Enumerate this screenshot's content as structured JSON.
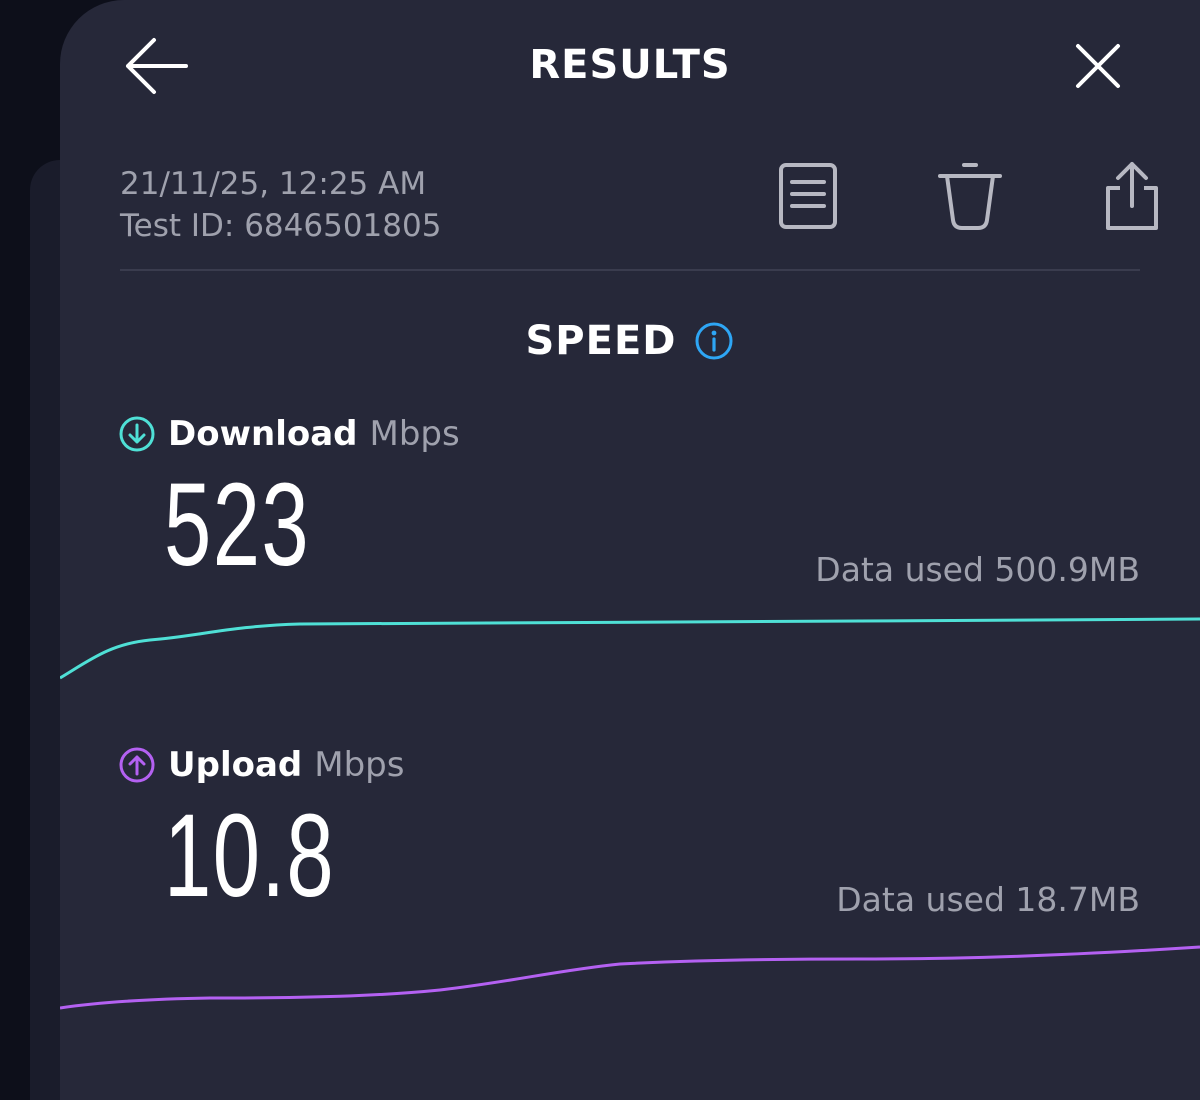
{
  "header": {
    "title": "RESULTS",
    "back_icon": "arrow-left-icon",
    "close_icon": "close-icon"
  },
  "meta": {
    "datetime": "21/11/25, 12:25 AM",
    "test_id": "Test ID: 6846501805"
  },
  "toolbar": {
    "icons": [
      "document-icon",
      "trash-icon",
      "share-icon"
    ]
  },
  "section": {
    "title": "SPEED",
    "info_icon": "info-icon",
    "info_color": "#2ea6f5"
  },
  "download": {
    "label": "Download",
    "unit": "Mbps",
    "value": "523",
    "data_used": "Data used 500.9MB",
    "color": "#4fe0d6"
  },
  "upload": {
    "label": "Upload",
    "unit": "Mbps",
    "value": "10.8",
    "data_used": "Data used 18.7MB",
    "color": "#b461f2"
  }
}
